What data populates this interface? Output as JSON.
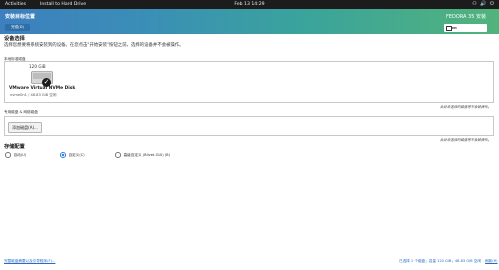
{
  "topbar": {
    "activities": "Activities",
    "app": "Install to Hard Drive",
    "clock": "Feb 13 14:29",
    "indicators": "⚇ 🔊 ⏻"
  },
  "header": {
    "title": "安装目标位置",
    "help": "完成(D)",
    "version": "FEDORA 35 安装",
    "keyboard": "cn"
  },
  "device_selection": {
    "heading": "设备选择",
    "description": "选择您想要将系统安装到的设备。在您点击\"开始安装\"按钮之前，选择的设备并不会被操作。"
  },
  "local_disks": {
    "label": "本地标准磁盘",
    "disk": {
      "size": "120 GiB",
      "name": "VMware Virtual NVMe Disk",
      "info": "nvme0n1 / 48.83 GiB 空闲"
    },
    "note": "此处未选择的磁盘将不会被操作。"
  },
  "special_disks": {
    "label": "专用磁盘 & 网络磁盘",
    "add_button": "添加磁盘(A)...",
    "note": "此处未选择的磁盘将不会被操作。"
  },
  "storage_config": {
    "heading": "存储配置",
    "options": [
      "自动(U)",
      "自定义(C)",
      "高级自定义 (Blivet-GUI) (B)"
    ],
    "selected_index": 1
  },
  "footer": {
    "link": "完整磁盘摘要以及引导程序(F)...",
    "status": "已选择 1 个磁盘；容量 120 GiB；48.83 GiB 空闲",
    "refresh": "刷新(R)"
  }
}
